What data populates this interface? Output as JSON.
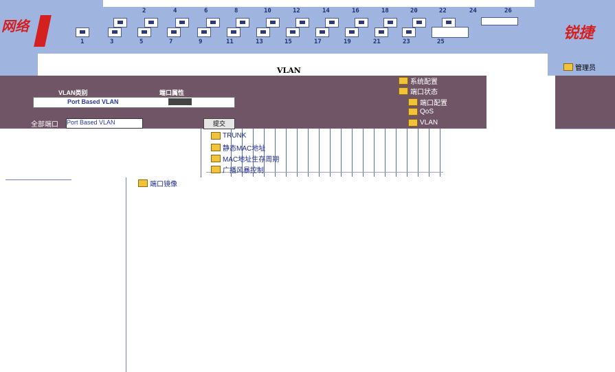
{
  "header": {
    "logo_left": "网络",
    "logo_right": "锐捷",
    "port_numbers_top": [
      "2",
      "4",
      "6",
      "8",
      "10",
      "12",
      "14",
      "16",
      "18",
      "20",
      "22",
      "24",
      "26"
    ],
    "port_numbers_bottom": [
      "1",
      "3",
      "5",
      "7",
      "9",
      "11",
      "13",
      "15",
      "17",
      "19",
      "21",
      "23",
      "25"
    ]
  },
  "page": {
    "title": "VLAN"
  },
  "form": {
    "vlan_label": "VLAN类别",
    "port_label": "端口属性",
    "select_row_text": "Port Based VLAN",
    "bottom_label": "全部端口",
    "select_value": "Port Based VLAN",
    "submit_label": "提交"
  },
  "menu": {
    "admin": "管理员",
    "system_config": "系统配置",
    "port_status": "端口状态",
    "port_config": "端口配置",
    "qos": "QoS",
    "vlan": "VLAN",
    "trunk": "TRUNK",
    "static_mac": "静态MAC地址",
    "mac_aging": "MAC地址生存周期",
    "broadcast_storm": "广播风暴控制",
    "port_mirror": "端口镜像"
  }
}
